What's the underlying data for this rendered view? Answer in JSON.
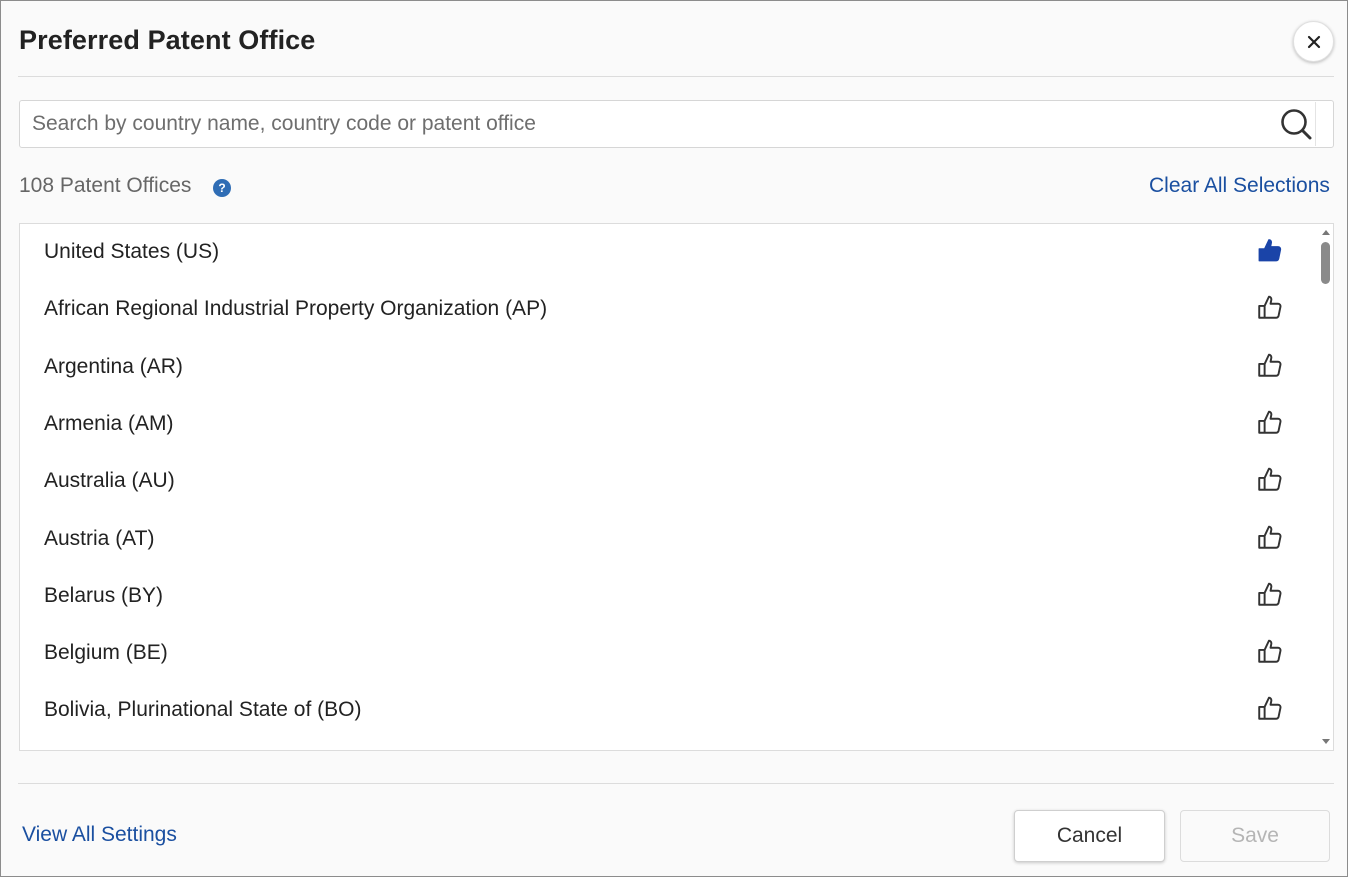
{
  "dialog": {
    "title": "Preferred Patent Office"
  },
  "search": {
    "placeholder": "Search by country name, country code or patent office",
    "value": ""
  },
  "summary": {
    "count_label": "108 Patent Offices",
    "help_glyph": "?",
    "clear_label": "Clear All Selections"
  },
  "offices": [
    {
      "label": "United States (US)",
      "preferred": true
    },
    {
      "label": "African Regional Industrial Property Organization (AP)",
      "preferred": false
    },
    {
      "label": "Argentina (AR)",
      "preferred": false
    },
    {
      "label": "Armenia (AM)",
      "preferred": false
    },
    {
      "label": "Australia (AU)",
      "preferred": false
    },
    {
      "label": "Austria (AT)",
      "preferred": false
    },
    {
      "label": "Belarus (BY)",
      "preferred": false
    },
    {
      "label": "Belgium (BE)",
      "preferred": false
    },
    {
      "label": "Bolivia, Plurinational State of (BO)",
      "preferred": false
    }
  ],
  "footer": {
    "view_all_label": "View All Settings",
    "cancel_label": "Cancel",
    "save_label": "Save"
  },
  "colors": {
    "link": "#1a4fa0",
    "selected_icon": "#1a44a8",
    "unselected_icon": "#333333"
  },
  "icons": {
    "close": "close-icon",
    "search": "search-icon",
    "help": "help-icon",
    "row": "thumbs-up-icon"
  }
}
